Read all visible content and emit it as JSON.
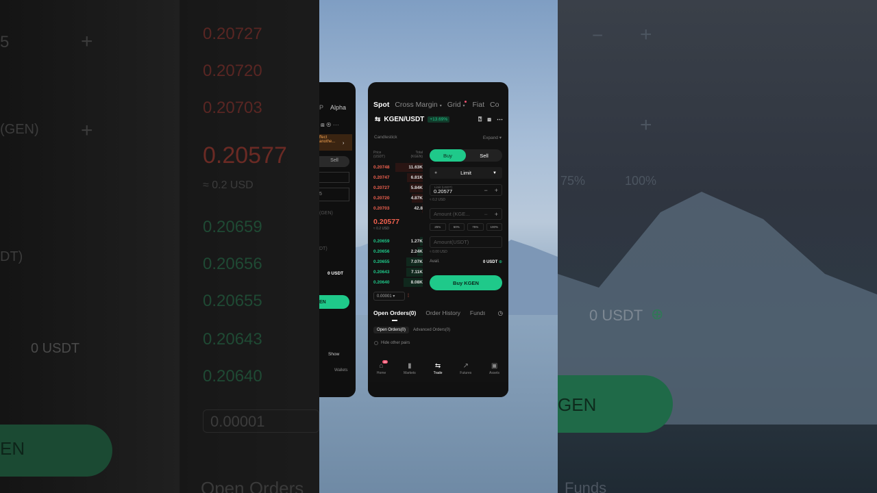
{
  "bg_left": {
    "asks": [
      "0.20727",
      "0.20720",
      "0.20703"
    ],
    "mid": "0.20577",
    "mid_sub": "≈ 0.2 USD",
    "bids": [
      "0.20659",
      "0.20656",
      "0.20655",
      "0.20643",
      "0.20640"
    ],
    "precision": "0.00001",
    "avail": "0 USDT",
    "frag_5": "5",
    "frag_gen": "(GEN)",
    "frag_dt": "DT)",
    "frag_en": "EN",
    "open_orders": "Open Orders"
  },
  "bg_right": {
    "p75": "75%",
    "p100": "100%",
    "avail": "0 USDT",
    "btn": "GEN",
    "funds": "Funds"
  },
  "back_card": {
    "tab_p": "P",
    "tab_alpha": "Alpha",
    "banner_1": "ffect",
    "banner_2": "anothe...",
    "sell": "Sell",
    "num_5": "5",
    "gen_label": "(GEN)",
    "dt_label": "DT)",
    "avail": "0 USDT",
    "btn": "EN",
    "show": "Show",
    "wallets": "Wallets"
  },
  "phone": {
    "tabs": [
      {
        "label": "Spot",
        "active": true
      },
      {
        "label": "Cross Margin",
        "active": false
      },
      {
        "label": "Grid",
        "active": false
      },
      {
        "label": "Fiat",
        "active": false
      },
      {
        "label": "Co",
        "active": false
      }
    ],
    "pair": "KGEN/USDT",
    "change": "+13.69%",
    "section": "Candlestick",
    "expand": "Expand",
    "ob_price_h": "Price (USDT)",
    "ob_total_h": "Total (KGEN)",
    "asks": [
      {
        "p": "0.20748",
        "v": "11.63K",
        "depth": 0.55
      },
      {
        "p": "0.20747",
        "v": "6.81K",
        "depth": 0.32
      },
      {
        "p": "0.20727",
        "v": "5.84K",
        "depth": 0.27
      },
      {
        "p": "0.20720",
        "v": "4.87K",
        "depth": 0.22
      },
      {
        "p": "0.20703",
        "v": "42.8",
        "depth": 0.02
      }
    ],
    "mid": "0.20577",
    "mid_sub": "≈ 0.2 USD",
    "bids": [
      {
        "p": "0.20659",
        "v": "1.27K",
        "depth": 0.06
      },
      {
        "p": "0.20656",
        "v": "2.24K",
        "depth": 0.11
      },
      {
        "p": "0.20655",
        "v": "7.07K",
        "depth": 0.34
      },
      {
        "p": "0.20643",
        "v": "7.11K",
        "depth": 0.34
      },
      {
        "p": "0.20640",
        "v": "8.08K",
        "depth": 0.39
      }
    ],
    "precision": "0.00001",
    "buy": "Buy",
    "sell": "Sell",
    "order_type": "Limit",
    "limit_label": "Limit (USDT)",
    "price": "0.20577",
    "price_sub": "≈ 0.2 USD",
    "amount_ph": "Amount (KGE...",
    "pcts": [
      "25%",
      "50%",
      "75%",
      "100%"
    ],
    "amount_usdt_ph": "Amount(USDT)",
    "amount_sub": "≈ 0.00 USD",
    "avail_label": "Avail.",
    "avail_val": "0 USDT",
    "buy_btn": "Buy KGEN",
    "otabs": [
      "Open Orders(0)",
      "Order History",
      "Funds"
    ],
    "osub": [
      "Open Orders(0)",
      "Advanced Orders(0)"
    ],
    "hide": "Hide other pairs",
    "nav": [
      {
        "label": "Home",
        "icon": "home-icon",
        "glyph": "⌂",
        "badge": "29"
      },
      {
        "label": "Markets",
        "icon": "markets-icon",
        "glyph": "▮",
        "badge": ""
      },
      {
        "label": "Trade",
        "icon": "trade-icon",
        "glyph": "⇆",
        "badge": "",
        "active": true
      },
      {
        "label": "Futures",
        "icon": "futures-icon",
        "glyph": "↗",
        "badge": ""
      },
      {
        "label": "Assets",
        "icon": "assets-icon",
        "glyph": "▣",
        "badge": ""
      }
    ]
  }
}
